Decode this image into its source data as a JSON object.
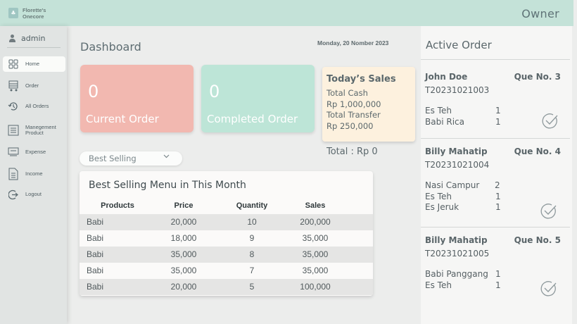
{
  "header": {
    "logo_glyph": "♣",
    "brand_line1": "Florette's",
    "brand_line2": "Onecore",
    "role": "Owner"
  },
  "sidebar": {
    "user": "admin",
    "items": [
      {
        "label": "Home",
        "icon": "grid-icon"
      },
      {
        "label": "Order",
        "icon": "cart-icon"
      },
      {
        "label": "All Orders",
        "icon": "history-icon"
      },
      {
        "label": "Manegement",
        "label2": "Product",
        "icon": "product-list-icon"
      },
      {
        "label": "Expense",
        "icon": "wallet-icon"
      },
      {
        "label": "Income",
        "icon": "document-icon"
      },
      {
        "label": "Logout",
        "icon": "logout-icon"
      }
    ]
  },
  "main": {
    "title": "Dashboard",
    "date": "Monday, 20 Nomber 2023",
    "cards": {
      "current_value": "0",
      "current_label": "Current Order",
      "completed_value": "0",
      "completed_label": "Completed Order"
    },
    "sales": {
      "title": "Today’s Sales",
      "cash_label": "Total Cash",
      "cash_value": "Rp 1,000,000",
      "transfer_label": "Total Transfer",
      "transfer_value": "Rp 250,000",
      "total": "Total : Rp 0"
    },
    "filter": {
      "selected": "Best Selling"
    },
    "table": {
      "title": "Best Selling Menu in This Month",
      "columns": [
        "Products",
        "Price",
        "Quantity",
        "Sales"
      ],
      "rows": [
        [
          "Babi",
          "20,000",
          "10",
          "200,000"
        ],
        [
          "Babi",
          "18,000",
          "9",
          "35,000"
        ],
        [
          "Babi",
          "35,000",
          "8",
          "35,000"
        ],
        [
          "Babi",
          "35,000",
          "7",
          "35,000"
        ],
        [
          "Babi",
          "20,000",
          "5",
          "100,000"
        ]
      ]
    }
  },
  "active_order": {
    "title": "Active Order",
    "orders": [
      {
        "name": "John Doe",
        "que": "Que No. 3",
        "code": "T20231021003",
        "items": [
          [
            "Es Teh",
            "1"
          ],
          [
            "Babi Rica",
            "1"
          ]
        ]
      },
      {
        "name": "Billy Mahatip",
        "que": "Que No. 4",
        "code": "T20231021004",
        "items": [
          [
            "Nasi Campur",
            "2"
          ],
          [
            "Es Teh",
            "1"
          ],
          [
            "Es Jeruk",
            "1"
          ]
        ]
      },
      {
        "name": "Billy Mahatip",
        "que": "Que No. 5",
        "code": "T20231021005",
        "items": [
          [
            "Babi Panggang",
            "1"
          ],
          [
            "Es Teh",
            "1"
          ]
        ]
      }
    ]
  }
}
